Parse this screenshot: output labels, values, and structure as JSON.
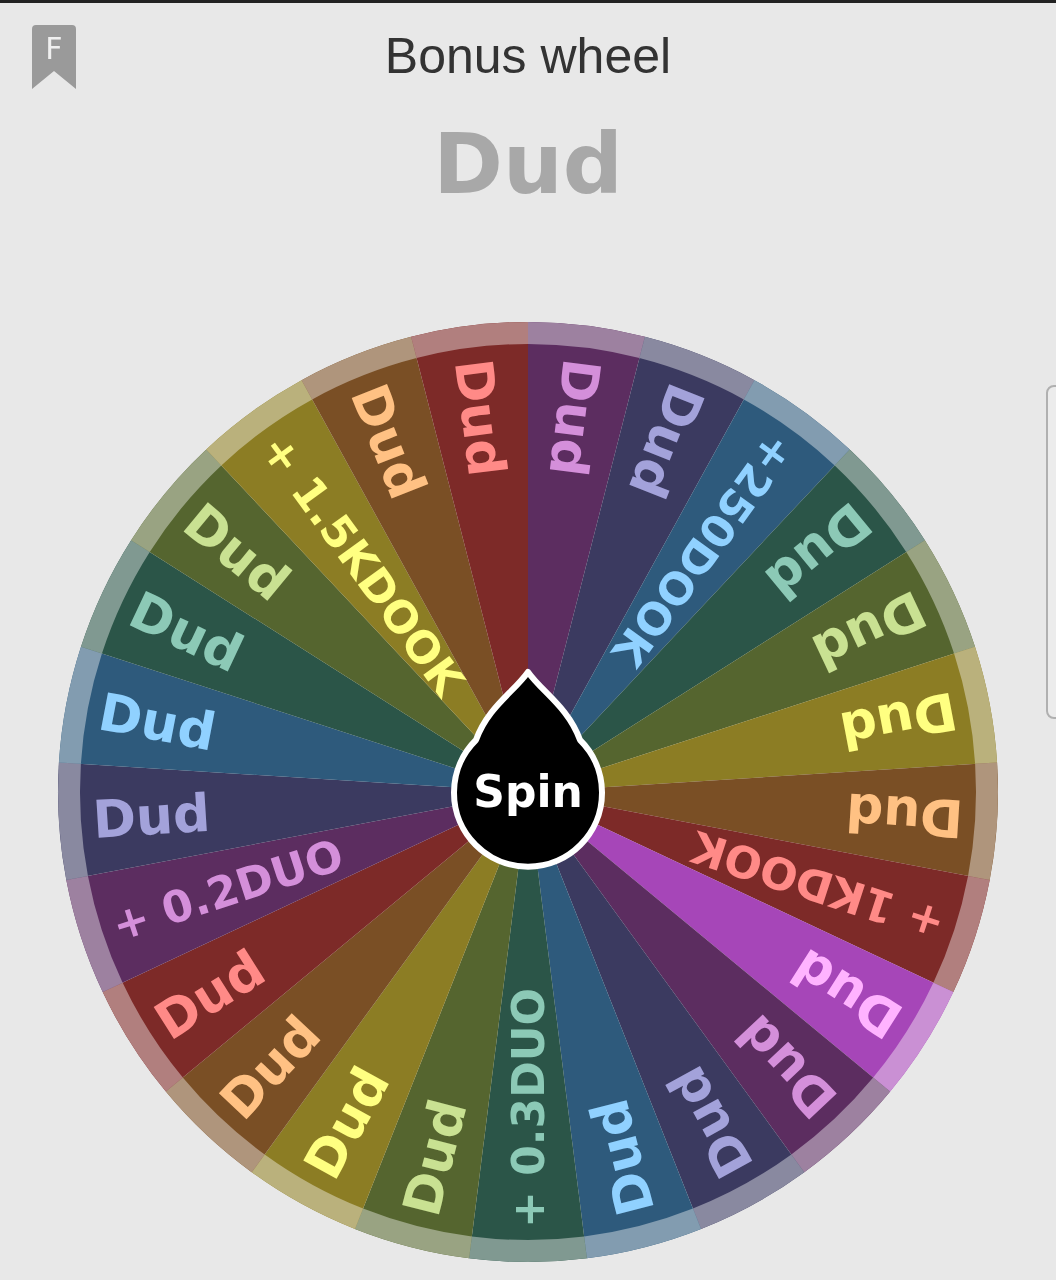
{
  "header": {
    "bookmark_letter": "F",
    "title": "Bonus wheel"
  },
  "result": "Dud",
  "wheel": {
    "spin_label": "Spin",
    "segments": [
      {
        "label": "Dud",
        "color": "#5c2d60"
      },
      {
        "label": "Dud",
        "color": "#3b3a60"
      },
      {
        "label": "+250DOOK",
        "color": "#2e5a7c"
      },
      {
        "label": "Dud",
        "color": "#2b5548"
      },
      {
        "label": "Dud",
        "color": "#55652f"
      },
      {
        "label": "Dud",
        "color": "#8c7d24"
      },
      {
        "label": "Dud",
        "color": "#7a4f25"
      },
      {
        "label": "+ 1KDOOK",
        "color": "#7d2a28"
      },
      {
        "label": "Dud",
        "color": "#a646b8"
      },
      {
        "label": "Dud",
        "color": "#5c2d60"
      },
      {
        "label": "Dud",
        "color": "#3b3a60"
      },
      {
        "label": "Dud",
        "color": "#2e5a7c"
      },
      {
        "label": "+ 0.3DUO",
        "color": "#2b5548"
      },
      {
        "label": "Dud",
        "color": "#55652f"
      },
      {
        "label": "Dud",
        "color": "#8c7d24"
      },
      {
        "label": "Dud",
        "color": "#7a4f25"
      },
      {
        "label": "Dud",
        "color": "#7d2a28"
      },
      {
        "label": "+ 0.2DUO",
        "color": "#5c2d60"
      },
      {
        "label": "Dud",
        "color": "#3b3a60"
      },
      {
        "label": "Dud",
        "color": "#2e5a7c"
      },
      {
        "label": "Dud",
        "color": "#2b5548"
      },
      {
        "label": "Dud",
        "color": "#55652f"
      },
      {
        "label": "+ 1.5KDOOK",
        "color": "#8c7d24"
      },
      {
        "label": "Dud",
        "color": "#7a4f25"
      },
      {
        "label": "Dud",
        "color": "#7d2a28"
      }
    ]
  }
}
